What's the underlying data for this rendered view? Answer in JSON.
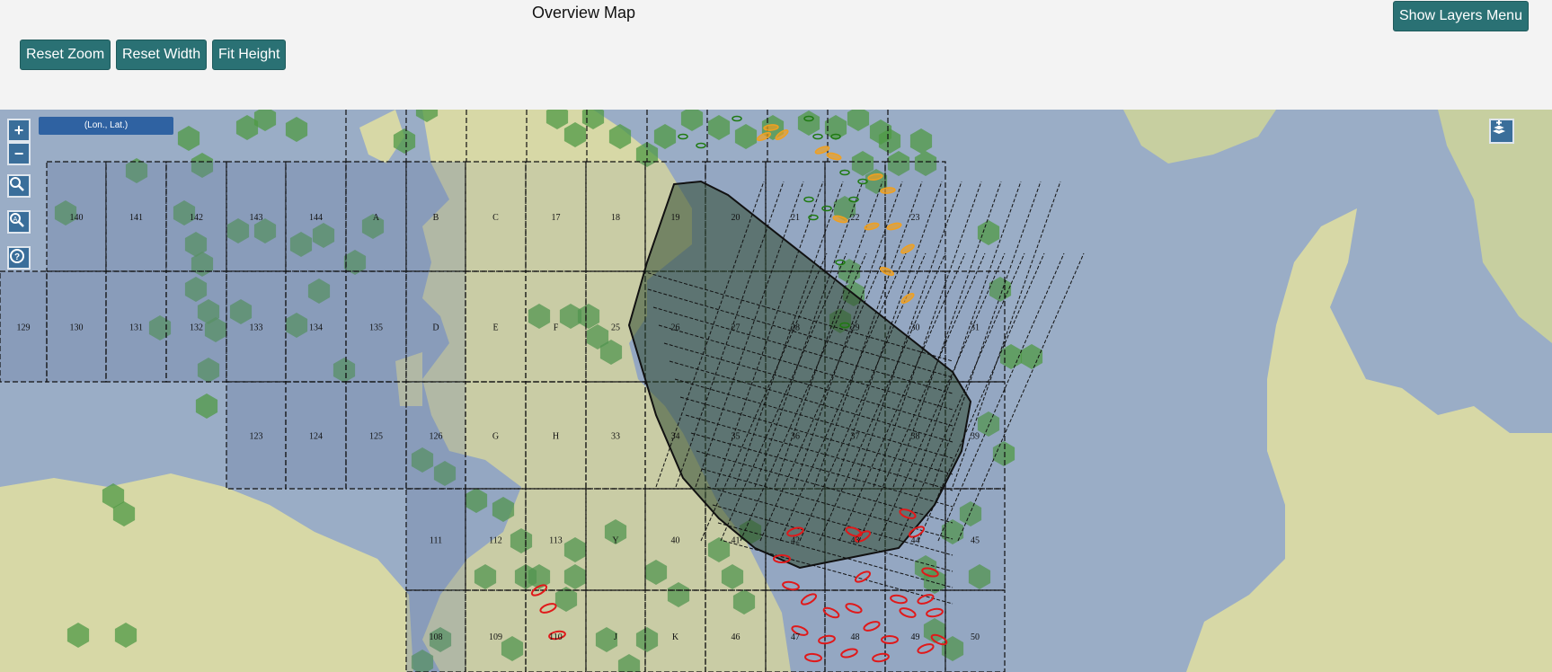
{
  "header": {
    "title": "Overview Map",
    "buttons": {
      "reset_zoom": "Reset Zoom",
      "reset_width": "Reset Width",
      "fit_height": "Fit Height",
      "layers_menu": "Show Layers Menu"
    }
  },
  "map": {
    "coord_readout": "(Lon., Lat.)",
    "zoom_in": "+",
    "zoom_out": "−",
    "block_labels": [
      "140",
      "141",
      "142",
      "143",
      "144",
      "A",
      "B",
      "C",
      "17",
      "18",
      "19",
      "20",
      "21",
      "22",
      "23",
      "129",
      "130",
      "131",
      "132",
      "133",
      "134",
      "135",
      "D",
      "E",
      "F",
      "25",
      "26",
      "27",
      "28",
      "29",
      "30",
      "31",
      "123",
      "124",
      "125",
      "126",
      "G",
      "H",
      "33",
      "34",
      "35",
      "36",
      "37",
      "38",
      "39",
      "111",
      "112",
      "113",
      "Y",
      "40",
      "41",
      "42",
      "43",
      "44",
      "45",
      "108",
      "109",
      "110",
      "J",
      "K",
      "46",
      "47",
      "48",
      "49",
      "50"
    ],
    "colors": {
      "sea": "#9aadc6",
      "land": "#d7d8a6",
      "grid_shade": "#6b7fa3",
      "hex": "#4f9a44",
      "survey": "#2f4a32",
      "field_red": "#e0191a",
      "field_orange": "#f0a020"
    },
    "icons": [
      "search-icon",
      "zoom-region-icon",
      "help-icon",
      "layers-icon"
    ]
  }
}
